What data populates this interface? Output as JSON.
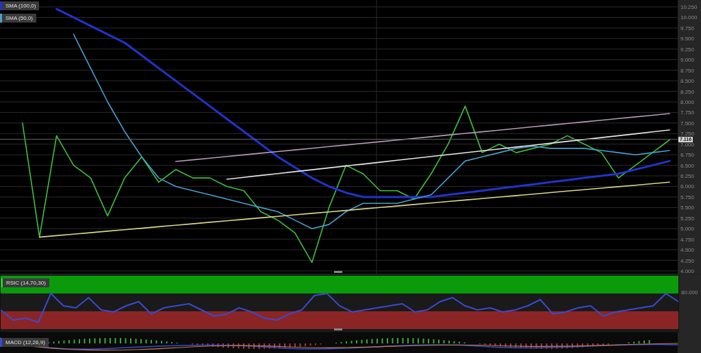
{
  "price_panel": {
    "chart_data": {
      "type": "line",
      "grid": true,
      "legend": "top-left",
      "ylim": [
        4000,
        10250
      ],
      "yticks": [
        {
          "value": 4000,
          "label": "4.000"
        },
        {
          "value": 4250,
          "label": "4.250"
        },
        {
          "value": 4500,
          "label": "4.500"
        },
        {
          "value": 4750,
          "label": "4.750"
        },
        {
          "value": 5000,
          "label": "5.000"
        },
        {
          "value": 5250,
          "label": "5.250"
        },
        {
          "value": 5500,
          "label": "5.500"
        },
        {
          "value": 5750,
          "label": "5.750"
        },
        {
          "value": 6000,
          "label": "6.000"
        },
        {
          "value": 6250,
          "label": "6.250"
        },
        {
          "value": 6500,
          "label": "6.500"
        },
        {
          "value": 6750,
          "label": "6.750"
        },
        {
          "value": 7000,
          "label": "7.000"
        },
        {
          "value": 7250,
          "label": "7.250"
        },
        {
          "value": 7500,
          "label": "7.500"
        },
        {
          "value": 7750,
          "label": "7.750"
        },
        {
          "value": 8000,
          "label": "8.000"
        },
        {
          "value": 8250,
          "label": "8.250"
        },
        {
          "value": 8500,
          "label": "8.500"
        },
        {
          "value": 8750,
          "label": "8.750"
        },
        {
          "value": 9000,
          "label": "9.000"
        },
        {
          "value": 9250,
          "label": "9.250"
        },
        {
          "value": 9500,
          "label": "9.500"
        },
        {
          "value": 9750,
          "label": "9.750"
        },
        {
          "value": 10000,
          "label": "10.000"
        },
        {
          "value": 10250,
          "label": "10.250"
        }
      ],
      "ref_lines": [
        {
          "axis": "y",
          "value": 7116,
          "label": "7.116"
        }
      ],
      "series": [
        {
          "color": "#3fbf3f",
          "values": [
            null,
            7500,
            4800,
            7200,
            6500,
            6200,
            5300,
            6200,
            6700,
            6100,
            6400,
            6200,
            6200,
            6000,
            5900,
            5400,
            5200,
            4900,
            4200,
            5500,
            6500,
            6300,
            5900,
            5900,
            5700,
            6300,
            7000,
            7900,
            6800,
            7000,
            6800,
            6900,
            7000,
            7200,
            7000,
            6800,
            6200,
            6500,
            6800,
            7100
          ]
        },
        {
          "name": "SMA (100,0)",
          "color": "#2233cc",
          "values": [
            null,
            null,
            null,
            10200,
            10000,
            9800,
            9600,
            9400,
            9100,
            8800,
            8500,
            8200,
            7900,
            7600,
            7300,
            7000,
            6700,
            6450,
            6200,
            6000,
            5850,
            5750,
            5750,
            5750,
            5750,
            5750,
            5800,
            5850,
            5900,
            5950,
            6000,
            6050,
            6100,
            6150,
            6200,
            6250,
            6300,
            6400,
            6500,
            6600
          ]
        },
        {
          "name": "SMA (50,0)",
          "color": "#4a9fd0",
          "values": [
            null,
            null,
            null,
            null,
            9600,
            8800,
            8000,
            7300,
            6700,
            6200,
            6000,
            5900,
            5800,
            5700,
            5600,
            5500,
            5400,
            5200,
            5000,
            5100,
            5400,
            5600,
            5600,
            5600,
            5700,
            5800,
            6200,
            6600,
            6700,
            6800,
            6900,
            6950,
            6900,
            6900,
            6900,
            6850,
            6800,
            6750,
            6800,
            6850
          ]
        },
        {
          "color": "#d8d88a",
          "values": [
            null,
            null,
            4800,
            4835,
            4870,
            4905,
            4940,
            4975,
            5011,
            5046,
            5081,
            5116,
            5151,
            5186,
            5221,
            5256,
            5292,
            5327,
            5362,
            5397,
            5432,
            5467,
            5502,
            5537,
            5573,
            5608,
            5643,
            5678,
            5713,
            5748,
            5783,
            5818,
            5854,
            5889,
            5924,
            5959,
            5994,
            6029,
            6064,
            6100
          ]
        },
        {
          "color": "#e8e8e8",
          "values": [
            null,
            null,
            null,
            null,
            null,
            null,
            null,
            null,
            null,
            null,
            null,
            null,
            null,
            6170,
            6215,
            6260,
            6304,
            6349,
            6394,
            6439,
            6484,
            6528,
            6573,
            6618,
            6663,
            6708,
            6752,
            6797,
            6842,
            6887,
            6932,
            6976,
            7021,
            7066,
            7111,
            7156,
            7200,
            7245,
            7290,
            7335
          ]
        },
        {
          "color": "#b89ab8",
          "values": [
            null,
            null,
            null,
            null,
            null,
            null,
            null,
            null,
            null,
            null,
            6590,
            6629,
            6668,
            6707,
            6746,
            6786,
            6825,
            6864,
            6903,
            6942,
            6981,
            7020,
            7059,
            7098,
            7137,
            7176,
            7215,
            7254,
            7294,
            7333,
            7372,
            7411,
            7450,
            7489,
            7528,
            7567,
            7606,
            7645,
            7684,
            7724
          ]
        }
      ]
    }
  },
  "rsi_panel": {
    "label": "RSIC (14,70,30)",
    "axis_label": "80.000"
  },
  "macd_panel": {
    "label": "MACD (12,26,9)"
  }
}
